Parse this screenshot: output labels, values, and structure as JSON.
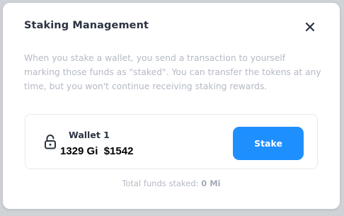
{
  "modal": {
    "title": "Staking Management",
    "description": "When you stake a wallet, you send a transaction to yourself marking those funds as \"staked\". You can transfer the tokens at any time, but you won't continue receiving staking rewards.",
    "close_icon": "close-icon"
  },
  "wallet": {
    "name": "Wallet 1",
    "balance": "1329 Gi  $1542",
    "lock_icon": "unlocked-padlock-icon"
  },
  "actions": {
    "stake_label": "Stake"
  },
  "footer": {
    "total_label": "Total funds staked:",
    "total_value": "0 Mi"
  },
  "colors": {
    "accent": "#1e8fff",
    "heading": "#2b3441",
    "muted": "#b4bac4"
  }
}
